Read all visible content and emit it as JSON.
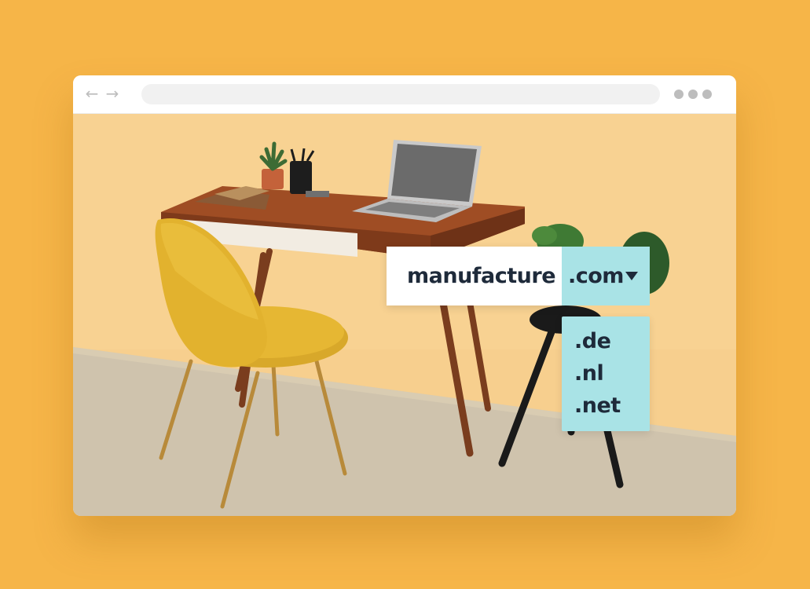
{
  "browser": {
    "nav": {
      "back_icon": "arrow-left-icon",
      "forward_icon": "arrow-right-icon"
    },
    "address_bar": {
      "value": ""
    },
    "menu_icon": "more-dots-icon"
  },
  "domain_search": {
    "name": "manufacture",
    "selected_tld": ".com",
    "dropdown_icon": "caret-down-icon",
    "options": [
      ".de",
      ".nl",
      ".net"
    ]
  },
  "colors": {
    "background": "#f6b548",
    "tld_highlight": "#a9e3e6",
    "text": "#1e2a3a"
  }
}
